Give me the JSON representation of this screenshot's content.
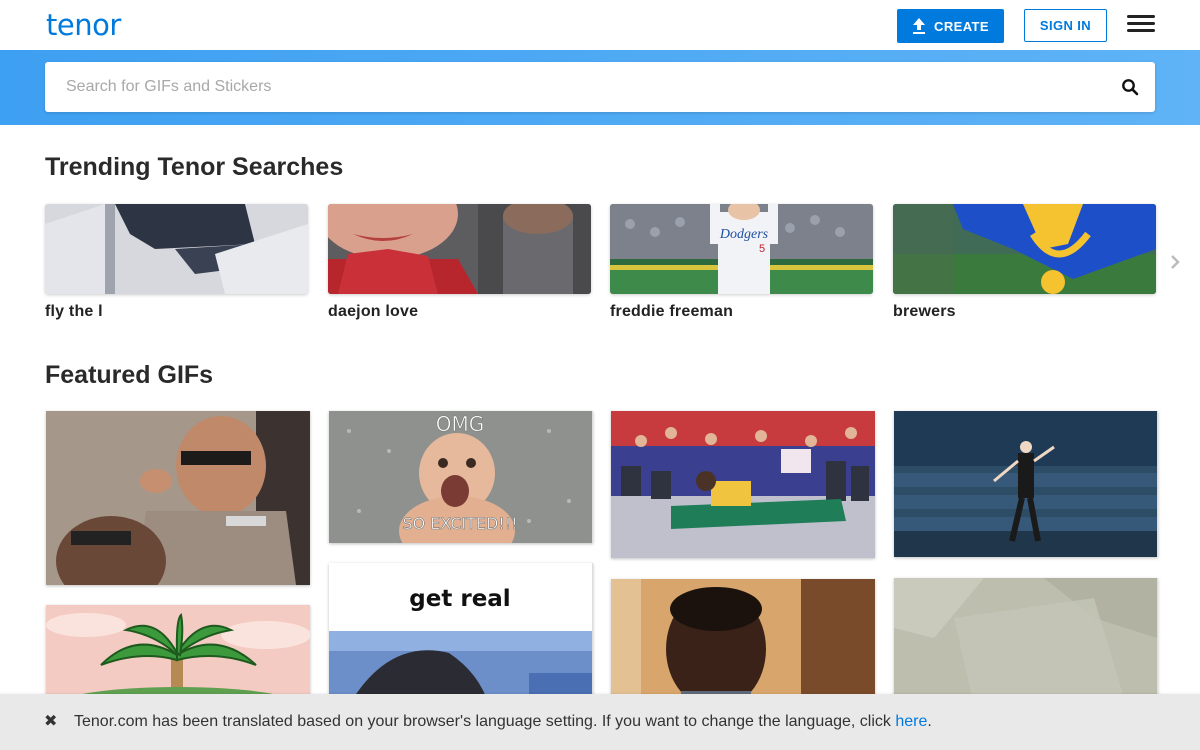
{
  "header": {
    "logo": "tenor",
    "create_label": "CREATE",
    "signin_label": "SIGN IN",
    "menu_icon": "hamburger-menu-icon"
  },
  "search": {
    "placeholder": "Search for GIFs and Stickers",
    "value": "",
    "icon": "search-icon"
  },
  "trending": {
    "title": "Trending Tenor Searches",
    "items": [
      {
        "label": "fly the l"
      },
      {
        "label": "daejon love"
      },
      {
        "label": "freddie freeman"
      },
      {
        "label": "brewers"
      }
    ],
    "next_icon": "chevron-right-icon"
  },
  "featured": {
    "title": "Featured GIFs",
    "gifs": [
      {
        "caption": ""
      },
      {
        "caption_top": "OMG",
        "caption_bottom": "SO EXCITED!!!"
      },
      {
        "caption": ""
      },
      {
        "caption": ""
      },
      {
        "caption": ""
      },
      {
        "caption": "get real"
      },
      {
        "caption": ""
      },
      {
        "caption": ""
      }
    ]
  },
  "banner": {
    "message": "Tenor.com has been translated based on your browser's language setting. If you want to change the language, click ",
    "link_text": "here",
    "end": ".",
    "close_icon": "close-icon"
  },
  "colors": {
    "brand": "#007add",
    "search_band": "#3ea0f2",
    "banner_bg": "#e9e9e9"
  }
}
